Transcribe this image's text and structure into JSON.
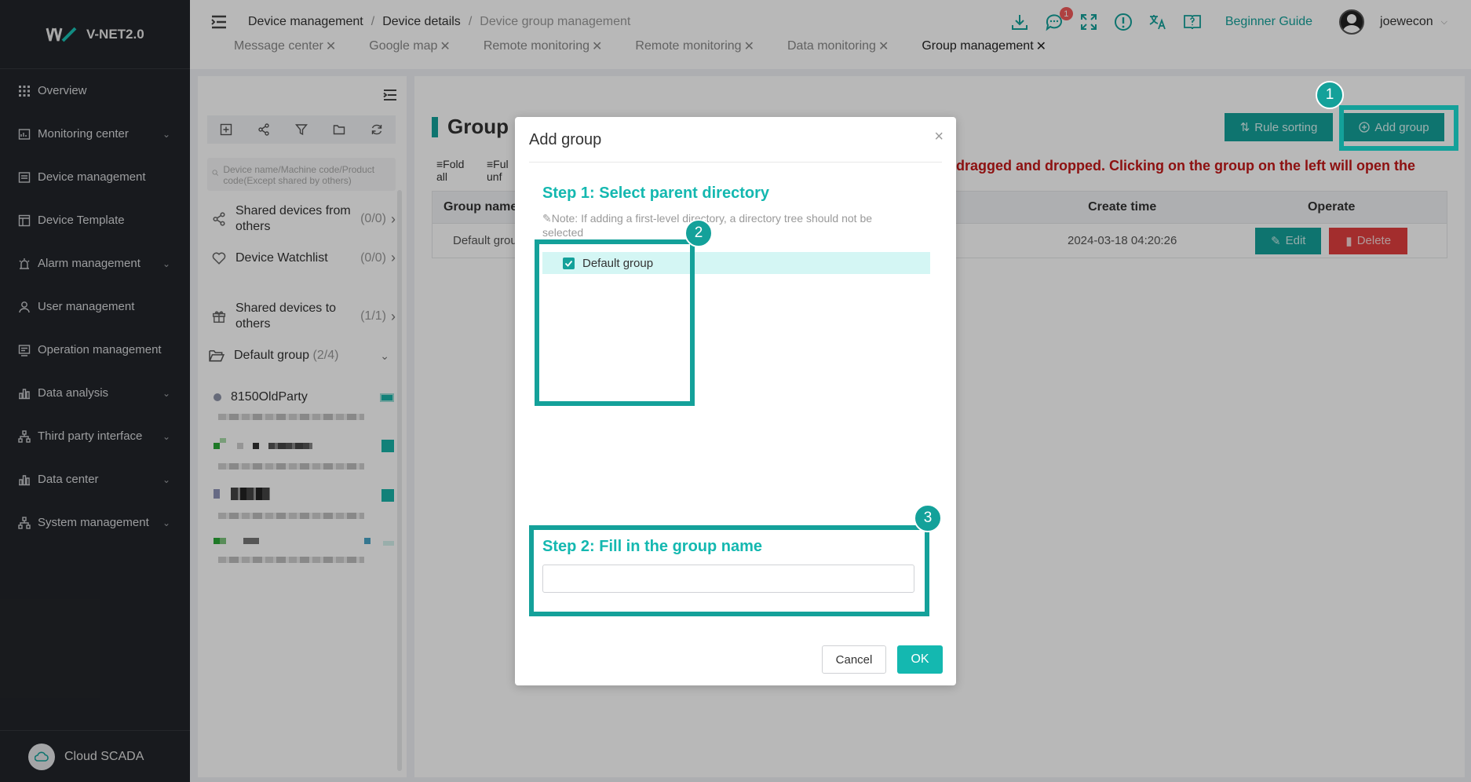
{
  "app": {
    "name": "V-NET2.0",
    "footer_label": "Cloud SCADA"
  },
  "sidebar": {
    "items": [
      {
        "label": "Overview",
        "icon": "grid-icon",
        "has_caret": false
      },
      {
        "label": "Monitoring center",
        "icon": "monitor-icon",
        "has_caret": true
      },
      {
        "label": "Device management",
        "icon": "device-icon",
        "has_caret": false
      },
      {
        "label": "Device Template",
        "icon": "template-icon",
        "has_caret": false
      },
      {
        "label": "Alarm management",
        "icon": "alarm-icon",
        "has_caret": true
      },
      {
        "label": "User management",
        "icon": "user-icon",
        "has_caret": false
      },
      {
        "label": "Operation management",
        "icon": "operation-icon",
        "has_caret": false
      },
      {
        "label": "Data analysis",
        "icon": "chart-icon",
        "has_caret": true
      },
      {
        "label": "Third party interface",
        "icon": "hierarchy-icon",
        "has_caret": true
      },
      {
        "label": "Data center",
        "icon": "chart-icon",
        "has_caret": true
      },
      {
        "label": "System management",
        "icon": "hierarchy-icon",
        "has_caret": true
      }
    ]
  },
  "header": {
    "breadcrumb": [
      "Device management",
      "Device details",
      "Device group management"
    ],
    "guide_label": "Beginner Guide",
    "username": "joewecon",
    "message_badge": "1",
    "tabs": [
      {
        "label": "Message center",
        "active": false
      },
      {
        "label": "Google map",
        "active": false
      },
      {
        "label": "Remote monitoring",
        "active": false
      },
      {
        "label": "Remote monitoring",
        "active": false
      },
      {
        "label": "Data monitoring",
        "active": false
      },
      {
        "label": "Group management",
        "active": true
      }
    ]
  },
  "device_panel": {
    "search_placeholder": "Device name/Machine code/Product code(Except shared by others)",
    "shared_from": {
      "label": "Shared devices from others",
      "count": "(0/0)"
    },
    "watchlist": {
      "label": "Device Watchlist",
      "count": "(0/0)"
    },
    "shared_to": {
      "label": "Shared devices to others",
      "count": "(1/1)"
    },
    "default_group": {
      "label": "Default group",
      "count": "(2/4)"
    },
    "first_device": "8150OldParty"
  },
  "main": {
    "title": "Group",
    "rule_sorting_label": "Rule sorting",
    "add_group_label": "Add group",
    "fold_label_1": "Fold",
    "fold_label_2": "all",
    "unfold_label_1": "Ful",
    "unfold_label_2": "unf",
    "notice": "dragged and dropped. Clicking on the group on the left will open the",
    "table": {
      "headers": [
        "Group name",
        "Create time",
        "Operate"
      ],
      "rows": [
        {
          "name": "Default grou",
          "create_time": "2024-03-18 04:20:26"
        }
      ],
      "edit_label": "Edit",
      "delete_label": "Delete"
    }
  },
  "modal": {
    "title": "Add group",
    "step1": "Step 1: Select parent directory",
    "note": "Note: If adding a first-level directory, a directory tree should not be selected",
    "tree_item": "Default group",
    "step2": "Step 2: Fill in the group name",
    "name_value": "",
    "cancel_label": "Cancel",
    "ok_label": "OK"
  },
  "annotations": [
    "1",
    "2",
    "3"
  ],
  "colors": {
    "accent": "#14a19a",
    "danger": "#e23f3f",
    "sidebar_bg": "#22252a",
    "notice": "#c41818"
  }
}
